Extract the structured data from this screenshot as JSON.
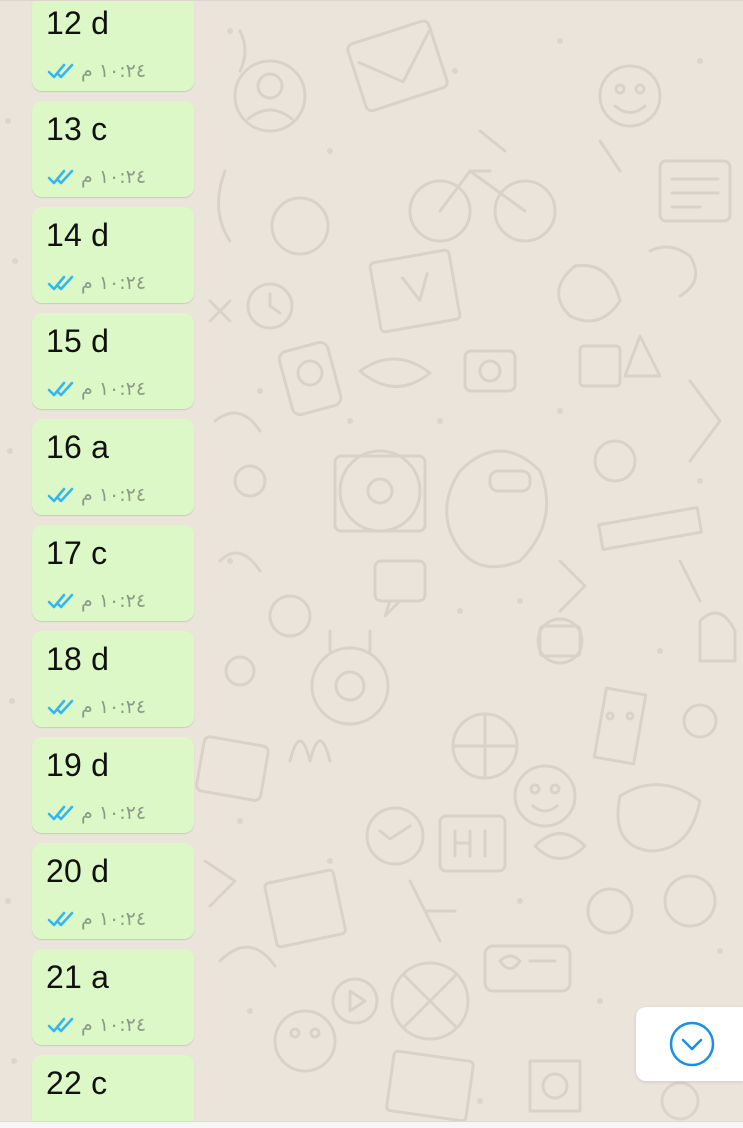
{
  "messages": [
    {
      "text": "12 d",
      "time": "١٠:٢٤ م"
    },
    {
      "text": "13 c",
      "time": "١٠:٢٤ م"
    },
    {
      "text": "14 d",
      "time": "١٠:٢٤ م"
    },
    {
      "text": "15 d",
      "time": "١٠:٢٤ م"
    },
    {
      "text": "16 a",
      "time": "١٠:٢٤ م"
    },
    {
      "text": "17 c",
      "time": "١٠:٢٤ م"
    },
    {
      "text": "18 d",
      "time": "١٠:٢٤ م"
    },
    {
      "text": "19 d",
      "time": "١٠:٢٤ م"
    },
    {
      "text": "20 d",
      "time": "١٠:٢٤ م"
    },
    {
      "text": "21 a",
      "time": "١٠:٢٤ م"
    },
    {
      "text": "22 c",
      "time": ""
    }
  ],
  "icons": {
    "read_receipt": "double-check-icon",
    "scroll_down": "chevron-down-icon"
  },
  "colors": {
    "outgoing_bubble": "#dcf8c6",
    "read_ticks": "#34b7f1",
    "chat_background": "#ebe4da",
    "time_text": "#8c9a85"
  }
}
